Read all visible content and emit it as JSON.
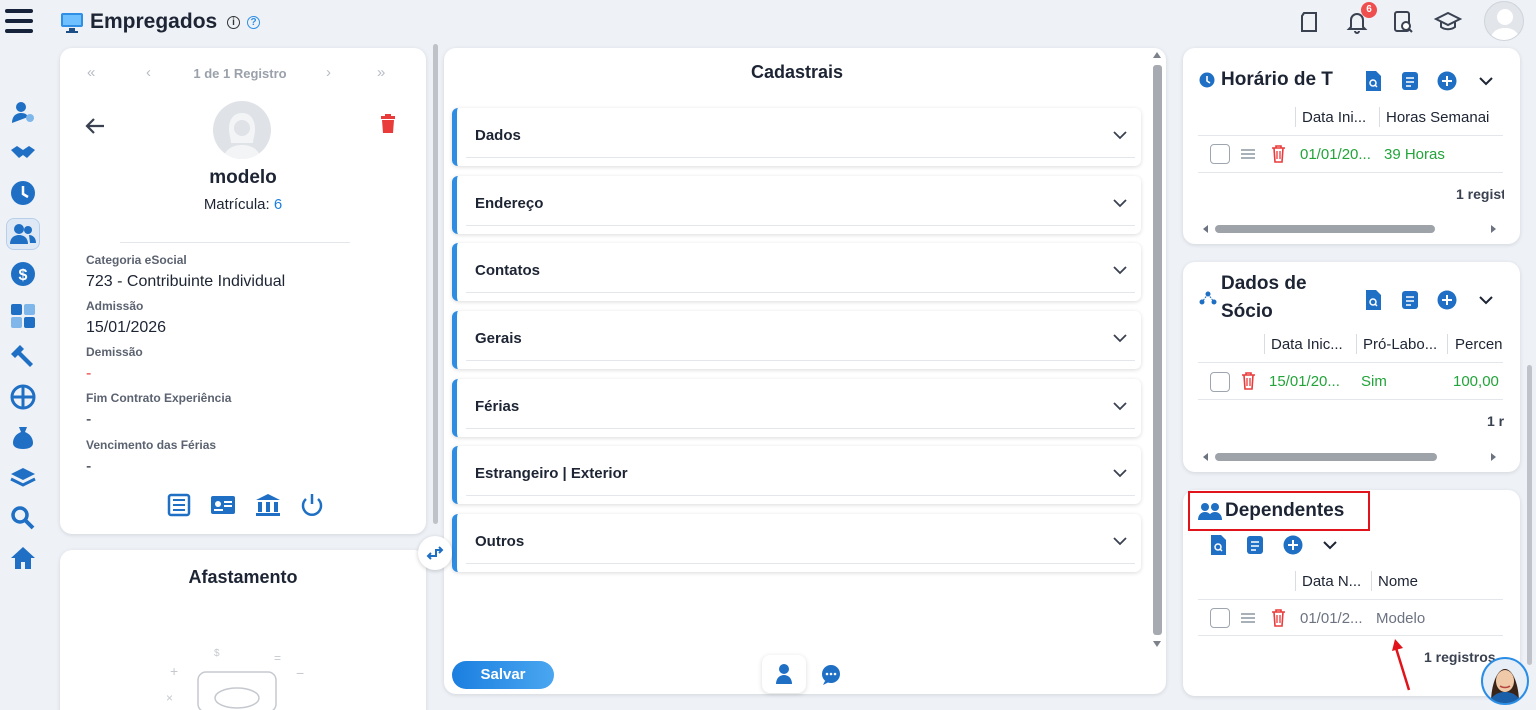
{
  "header": {
    "title": "Empregados",
    "notifications_count": "6"
  },
  "employee": {
    "nav_label": "1 de 1 Registro",
    "name": "modelo",
    "matricula_label": "Matrícula:",
    "matricula_value": "6",
    "fields": [
      {
        "label": "Categoria eSocial",
        "value": "723 - Contribuinte Individual"
      },
      {
        "label": "Admissão",
        "value": "15/01/2026"
      },
      {
        "label": "Demissão",
        "value": "-"
      },
      {
        "label": "Fim Contrato Experiência",
        "value": "-"
      },
      {
        "label": "Vencimento das Férias",
        "value": "-"
      }
    ]
  },
  "afastamento": {
    "title": "Afastamento"
  },
  "cadastrais": {
    "title": "Cadastrais",
    "sections": [
      "Dados",
      "Endereço",
      "Contatos",
      "Gerais",
      "Férias",
      "Estrangeiro | Exterior",
      "Outros"
    ],
    "save_label": "Salvar"
  },
  "horario": {
    "title": "Horário de T",
    "columns": [
      "Data Ini...",
      "Horas Semanai"
    ],
    "row": [
      "01/01/20...",
      "39 Horas"
    ],
    "count": "1 regist"
  },
  "socio": {
    "title_line1": "Dados de",
    "title_line2": "Sócio",
    "columns": [
      "Data Inic...",
      "Pró-Labo...",
      "Percen"
    ],
    "row": [
      "15/01/20...",
      "Sim",
      "100,00"
    ],
    "count": "1 r"
  },
  "dependentes": {
    "title": "Dependentes",
    "columns": [
      "Data N...",
      "Nome"
    ],
    "row": [
      "01/01/2...",
      "Modelo"
    ],
    "count": "1 registros"
  },
  "colors": {
    "accent": "#1b7fe0",
    "danger": "#ef4e4e",
    "success": "#22a43a",
    "highlight_box": "#e0141a"
  }
}
